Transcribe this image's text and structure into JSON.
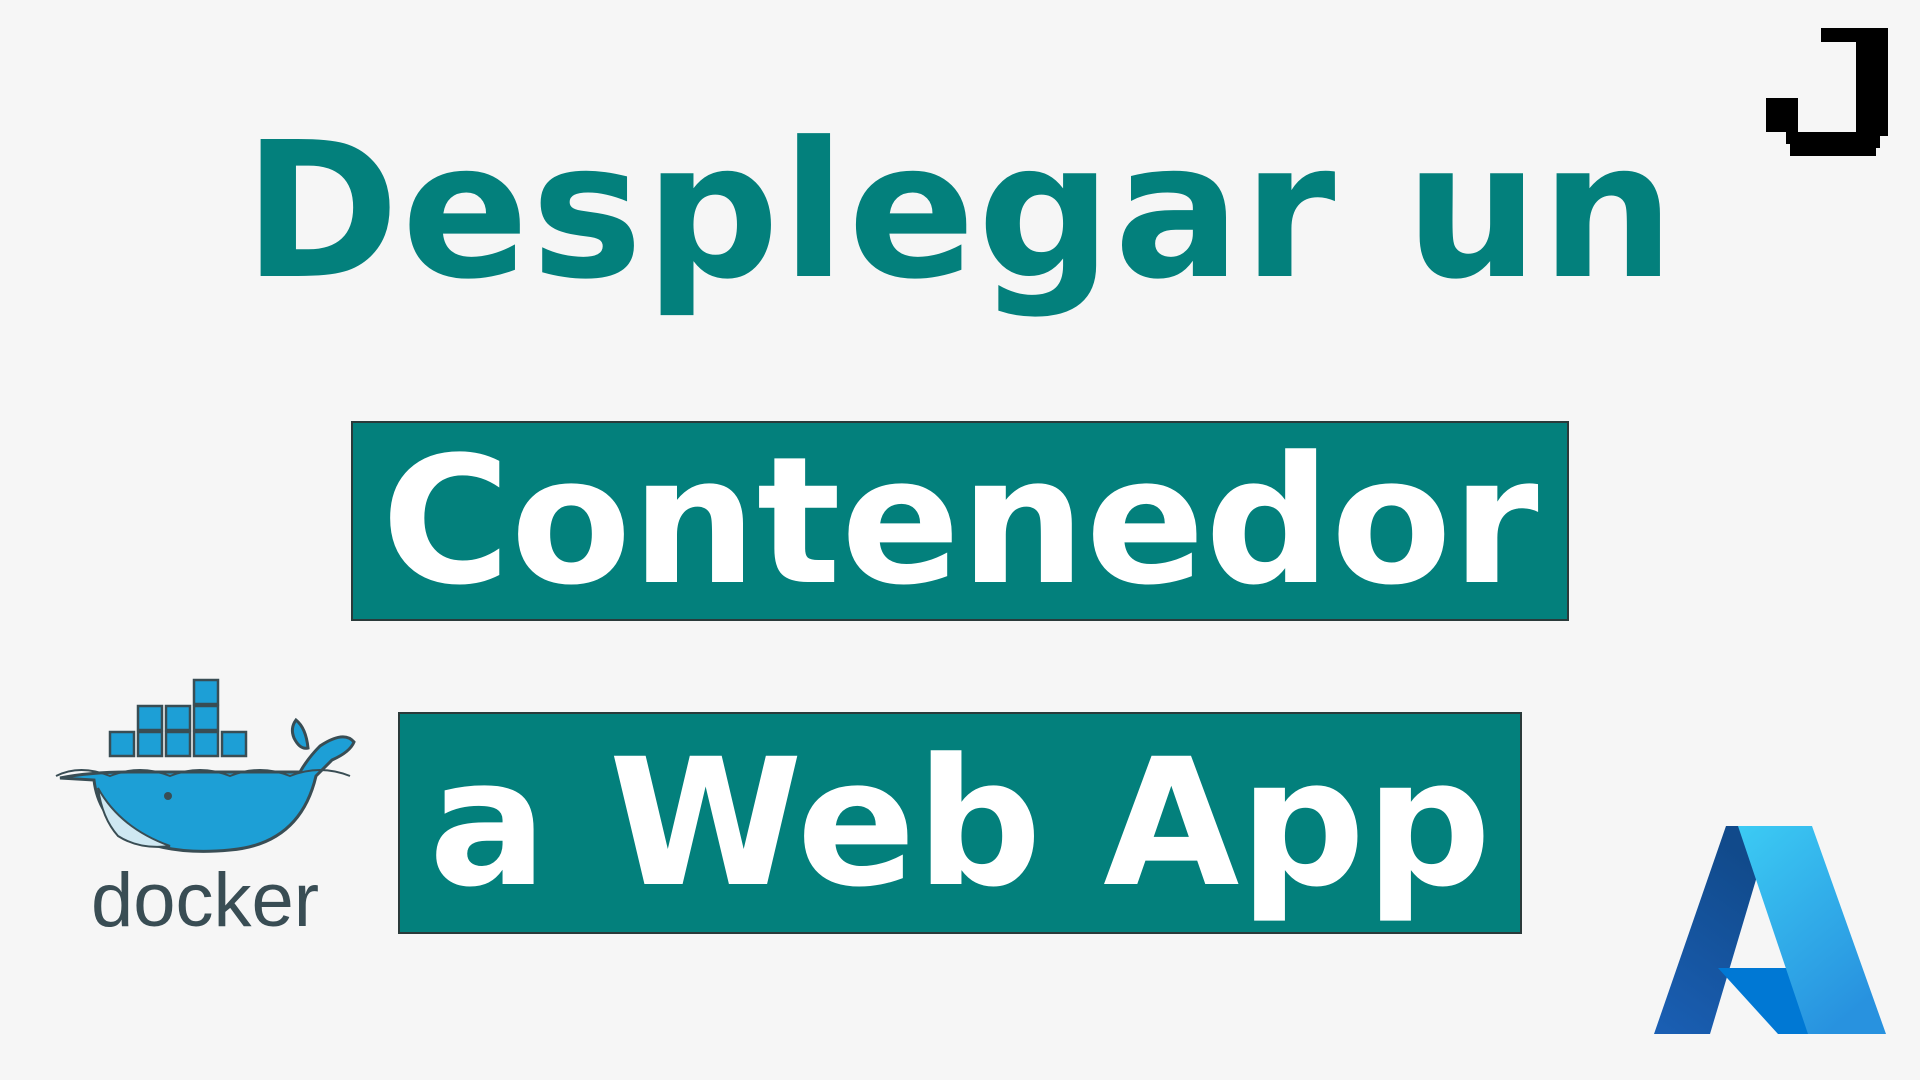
{
  "title": "Desplegar un",
  "banner_line_1": "Contenedor",
  "banner_line_2": "a Web App",
  "docker_wordmark": "docker",
  "colors": {
    "background": "#f6f6f6",
    "accent_teal": "#03807c",
    "banner_text": "#ffffff",
    "docker_blue": "#1d9fd6",
    "docker_dark": "#394d54"
  },
  "icons": [
    "brand-logo-icon",
    "docker-logo-icon",
    "azure-logo-icon"
  ]
}
